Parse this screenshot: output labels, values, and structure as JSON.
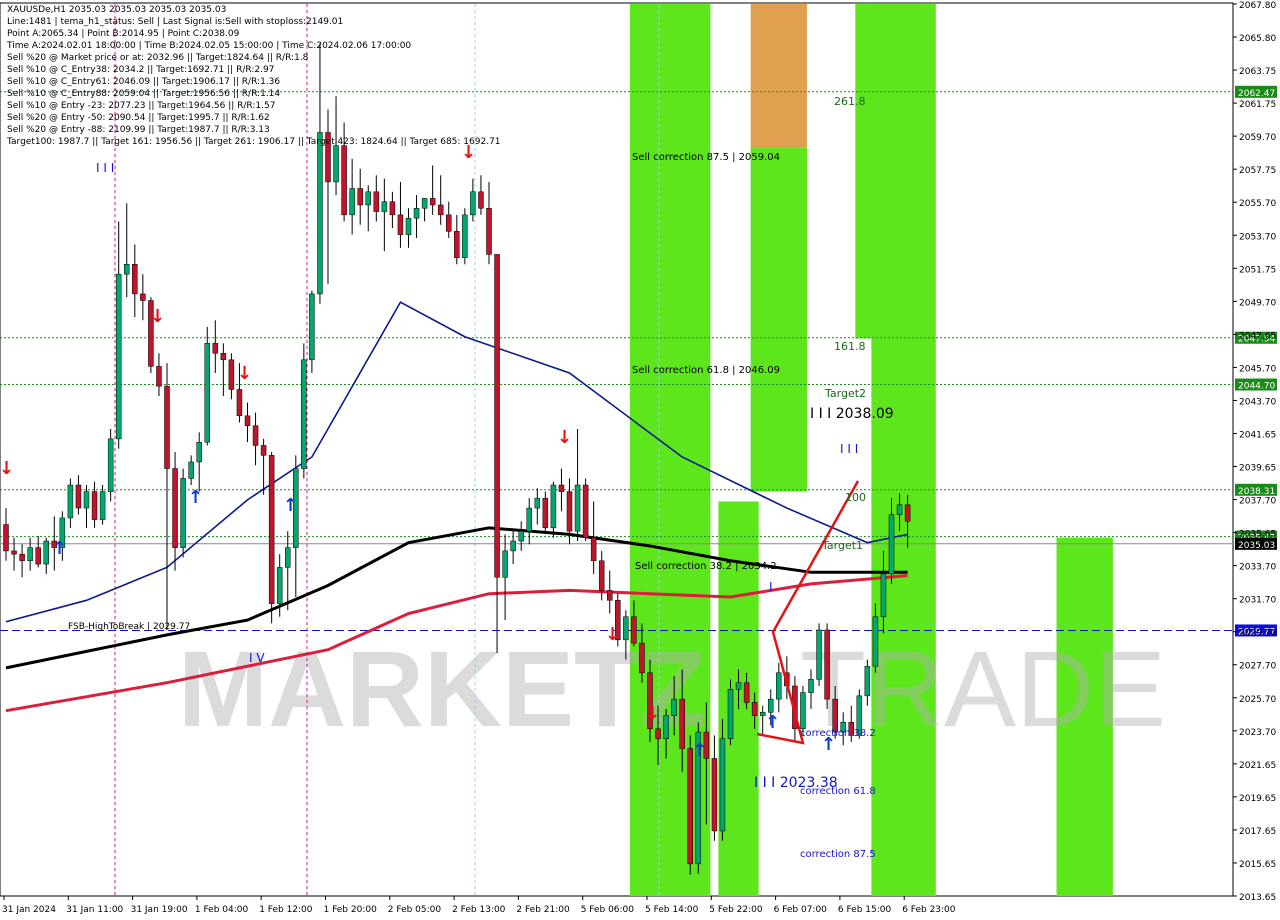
{
  "header": {
    "symbol_line": "XAUUSDe,H1  2035.03 2035.03 2035.03 2035.03",
    "lines": [
      "Line:1481 | tema_h1_status: Sell | Last Signal is:Sell with stoploss:2149.01",
      "Point A:2065.34 | Point B:2014.95 | Point C:2038.09",
      "Time A:2024.02.01 18:00:00 | Time B:2024.02.05 15:00:00 | Time C:2024.02.06 17:00:00",
      "Sell %20 @ Market price or at: 2032.96 || Target:1824.64 || R/R:1.8",
      "Sell %10 @ C_Entry38: 2034.2 || Target:1692.71 || R/R:2.97",
      "Sell %10 @ C_Entry61: 2046.09 || Target:1906.17 || R/R:1.36",
      "Sell %10 @ C_Entry88: 2059.04 || Target:1956.56 || R/R:1.14",
      "Sell %10 @ Entry -23: 2077.23 || Target:1964.56 || R/R:1.57",
      "Sell %20 @ Entry -50: 2090.54 || Target:1995.7 || R/R:1.62",
      "Sell %20 @ Entry -88: 2109.99 || Target:1987.7 || R/R:3.13",
      "Target100: 1987.7 || Target 161: 1956.56 || Target 261: 1906.17 || Target 423: 1824.64 || Target 685: 1692.71"
    ]
  },
  "watermark": {
    "left": "MARKETZ",
    "right": "TRADE"
  },
  "colors": {
    "bull": "#00a86b",
    "bear": "#c0142a",
    "green_zone": "#5ee61c",
    "orange_zone": "#e0a050",
    "gray_zone": "#7f8b99",
    "ma_blue": "#0a1a8c",
    "ma_black": "#000000",
    "ma_red": "#dc1e3c",
    "hline_green": "#1a8a1a",
    "hline_blue": "#0d0ddc",
    "price_box": "#1a8a1a"
  },
  "chart_data": {
    "type": "candlestick",
    "symbol": "XAUUSDe",
    "timeframe": "H1",
    "ylim": [
      2013.65,
      2067.8
    ],
    "y_ticks": [
      "2067.80",
      "2065.80",
      "2063.75",
      "2061.75",
      "2059.70",
      "2057.75",
      "2055.70",
      "2053.70",
      "2051.75",
      "2049.70",
      "2047.65",
      "2045.70",
      "2043.70",
      "2041.65",
      "2039.65",
      "2037.70",
      "2035.65",
      "2033.70",
      "2031.70",
      "2029.70",
      "2027.70",
      "2025.70",
      "2023.70",
      "2021.65",
      "2019.65",
      "2017.65",
      "2015.65",
      "2013.65"
    ],
    "x_ticks": [
      "31 Jan 2024",
      "31 Jan 11:00",
      "31 Jan 19:00",
      "1 Feb 04:00",
      "1 Feb 12:00",
      "1 Feb 20:00",
      "2 Feb 05:00",
      "2 Feb 13:00",
      "2 Feb 21:00",
      "5 Feb 06:00",
      "5 Feb 14:00",
      "5 Feb 22:00",
      "6 Feb 07:00",
      "6 Feb 15:00",
      "6 Feb 23:00"
    ],
    "candle_count": 113,
    "candles": [
      [
        2036.2,
        2037.2,
        2034.0,
        2034.6
      ],
      [
        2034.6,
        2035.4,
        2033.4,
        2034.4
      ],
      [
        2034.4,
        2035.0,
        2033.0,
        2034.0
      ],
      [
        2034.0,
        2035.4,
        2033.4,
        2034.8
      ],
      [
        2034.8,
        2035.5,
        2033.6,
        2033.8
      ],
      [
        2033.8,
        2035.4,
        2033.2,
        2035.2
      ],
      [
        2035.2,
        2036.7,
        2033.4,
        2034.8
      ],
      [
        2034.8,
        2037.0,
        2034.0,
        2036.6
      ],
      [
        2036.6,
        2039.0,
        2036.0,
        2038.6
      ],
      [
        2038.6,
        2039.2,
        2036.8,
        2037.2
      ],
      [
        2037.2,
        2038.6,
        2036.0,
        2038.2
      ],
      [
        2038.2,
        2038.8,
        2036.0,
        2036.5
      ],
      [
        2036.5,
        2038.6,
        2036.2,
        2038.2
      ],
      [
        2038.2,
        2042.0,
        2037.6,
        2041.4
      ],
      [
        2041.4,
        2054.6,
        2040.8,
        2051.4
      ],
      [
        2051.4,
        2055.7,
        2050.0,
        2052.0
      ],
      [
        2052.0,
        2053.2,
        2048.8,
        2050.2
      ],
      [
        2050.2,
        2051.4,
        2048.6,
        2049.8
      ],
      [
        2049.8,
        2050.0,
        2045.4,
        2045.8
      ],
      [
        2045.8,
        2046.6,
        2044.0,
        2044.6
      ],
      [
        2044.6,
        2046.0,
        2029.8,
        2039.6
      ],
      [
        2039.6,
        2040.6,
        2033.4,
        2034.8
      ],
      [
        2034.8,
        2039.6,
        2034.2,
        2039.0
      ],
      [
        2039.0,
        2040.4,
        2038.6,
        2040.0
      ],
      [
        2040.0,
        2041.8,
        2038.2,
        2041.2
      ],
      [
        2041.2,
        2048.2,
        2041.0,
        2047.2
      ],
      [
        2047.2,
        2048.6,
        2045.4,
        2046.6
      ],
      [
        2046.6,
        2047.2,
        2044.0,
        2046.2
      ],
      [
        2046.2,
        2046.6,
        2043.8,
        2044.4
      ],
      [
        2044.4,
        2046.0,
        2042.4,
        2042.8
      ],
      [
        2042.8,
        2043.6,
        2041.2,
        2042.2
      ],
      [
        2042.2,
        2043.0,
        2039.8,
        2041.0
      ],
      [
        2041.0,
        2041.4,
        2038.0,
        2040.4
      ],
      [
        2040.4,
        2040.6,
        2030.2,
        2031.4
      ],
      [
        2031.4,
        2034.4,
        2030.6,
        2033.6
      ],
      [
        2033.6,
        2035.8,
        2031.0,
        2034.8
      ],
      [
        2034.8,
        2040.4,
        2031.8,
        2039.6
      ],
      [
        2039.6,
        2047.2,
        2039.0,
        2046.2
      ],
      [
        2046.2,
        2050.4,
        2045.4,
        2050.2
      ],
      [
        2050.2,
        2065.4,
        2049.6,
        2060.0
      ],
      [
        2060.0,
        2061.4,
        2050.8,
        2057.0
      ],
      [
        2057.0,
        2062.2,
        2056.2,
        2059.2
      ],
      [
        2059.2,
        2060.6,
        2054.6,
        2055.0
      ],
      [
        2055.0,
        2058.4,
        2053.8,
        2056.6
      ],
      [
        2056.6,
        2057.8,
        2054.4,
        2055.6
      ],
      [
        2055.6,
        2056.8,
        2054.0,
        2056.4
      ],
      [
        2056.4,
        2057.4,
        2054.6,
        2055.2
      ],
      [
        2055.2,
        2057.2,
        2052.8,
        2055.8
      ],
      [
        2055.8,
        2056.4,
        2054.2,
        2055.0
      ],
      [
        2055.0,
        2057.0,
        2053.0,
        2053.8
      ],
      [
        2053.8,
        2055.4,
        2053.0,
        2054.8
      ],
      [
        2054.8,
        2056.2,
        2053.6,
        2055.4
      ],
      [
        2055.4,
        2056.0,
        2054.6,
        2056.0
      ],
      [
        2056.0,
        2058.0,
        2055.0,
        2055.6
      ],
      [
        2055.6,
        2057.4,
        2054.4,
        2055.0
      ],
      [
        2055.0,
        2055.8,
        2053.6,
        2054.0
      ],
      [
        2054.0,
        2055.0,
        2052.0,
        2052.4
      ],
      [
        2052.4,
        2055.4,
        2052.0,
        2055.0
      ],
      [
        2055.0,
        2057.2,
        2054.6,
        2056.4
      ],
      [
        2056.4,
        2057.4,
        2055.0,
        2055.4
      ],
      [
        2055.4,
        2057.0,
        2052.0,
        2052.6
      ],
      [
        2052.6,
        2034.0,
        2028.4,
        2033.0
      ],
      [
        2033.0,
        2035.6,
        2030.4,
        2034.6
      ],
      [
        2034.6,
        2035.8,
        2033.8,
        2035.2
      ],
      [
        2035.2,
        2036.4,
        2034.6,
        2035.8
      ],
      [
        2035.8,
        2037.8,
        2035.0,
        2037.2
      ],
      [
        2037.2,
        2038.4,
        2036.2,
        2037.8
      ],
      [
        2037.8,
        2038.2,
        2035.8,
        2036.0
      ],
      [
        2036.0,
        2038.8,
        2035.4,
        2038.6
      ],
      [
        2038.6,
        2039.6,
        2037.0,
        2038.2
      ],
      [
        2038.2,
        2039.0,
        2035.0,
        2035.8
      ],
      [
        2035.8,
        2042.0,
        2035.2,
        2038.6
      ],
      [
        2038.6,
        2039.0,
        2035.2,
        2035.4
      ],
      [
        2035.4,
        2037.6,
        2033.2,
        2034.0
      ],
      [
        2034.0,
        2034.6,
        2031.6,
        2032.2
      ],
      [
        2032.2,
        2033.4,
        2030.8,
        2031.6
      ],
      [
        2031.6,
        2032.0,
        2028.8,
        2029.2
      ],
      [
        2029.2,
        2031.0,
        2028.0,
        2030.6
      ],
      [
        2030.6,
        2031.6,
        2028.8,
        2029.0
      ],
      [
        2029.0,
        2030.2,
        2026.6,
        2027.2
      ],
      [
        2027.2,
        2028.0,
        2023.0,
        2023.8
      ],
      [
        2023.8,
        2025.2,
        2021.6,
        2023.2
      ],
      [
        2023.2,
        2025.0,
        2022.0,
        2024.6
      ],
      [
        2024.6,
        2027.0,
        2023.4,
        2025.6
      ],
      [
        2025.6,
        2027.4,
        2021.2,
        2022.6
      ],
      [
        2022.6,
        2023.4,
        2014.95,
        2015.6
      ],
      [
        2015.6,
        2024.2,
        2015.0,
        2023.6
      ],
      [
        2023.6,
        2025.4,
        2018.0,
        2022.0
      ],
      [
        2022.0,
        2023.4,
        2017.0,
        2017.6
      ],
      [
        2017.6,
        2024.4,
        2017.0,
        2023.2
      ],
      [
        2023.2,
        2026.8,
        2022.8,
        2026.2
      ],
      [
        2026.2,
        2027.4,
        2025.0,
        2026.6
      ],
      [
        2026.6,
        2027.2,
        2025.0,
        2025.4
      ],
      [
        2025.4,
        2026.0,
        2023.8,
        2024.6
      ],
      [
        2024.6,
        2025.2,
        2023.4,
        2024.8
      ],
      [
        2024.8,
        2026.2,
        2024.0,
        2025.6
      ],
      [
        2025.6,
        2027.8,
        2024.8,
        2027.2
      ],
      [
        2027.2,
        2028.2,
        2025.6,
        2026.4
      ],
      [
        2026.4,
        2027.0,
        2023.0,
        2023.8
      ],
      [
        2023.8,
        2026.4,
        2023.4,
        2026.0
      ],
      [
        2026.0,
        2027.4,
        2025.0,
        2026.8
      ],
      [
        2026.8,
        2030.2,
        2026.4,
        2029.8
      ],
      [
        2029.8,
        2030.2,
        2025.0,
        2025.6
      ],
      [
        2025.6,
        2026.4,
        2023.2,
        2023.6
      ],
      [
        2023.6,
        2024.8,
        2022.8,
        2024.2
      ],
      [
        2024.2,
        2025.2,
        2023.0,
        2023.4
      ],
      [
        2023.4,
        2026.2,
        2023.2,
        2025.8
      ],
      [
        2025.8,
        2028.0,
        2025.2,
        2027.6
      ],
      [
        2027.6,
        2031.4,
        2027.2,
        2030.6
      ],
      [
        2030.6,
        2034.6,
        2029.6,
        2033.2
      ],
      [
        2033.2,
        2037.8,
        2032.6,
        2036.8
      ],
      [
        2036.8,
        2038.09,
        2035.8,
        2037.4
      ],
      [
        2037.4,
        2038.0,
        2034.8,
        2036.4
      ]
    ],
    "moving_averages": [
      {
        "name": "blue",
        "points": [
          [
            0,
            2030.3
          ],
          [
            10,
            2031.6
          ],
          [
            20,
            2033.6
          ],
          [
            30,
            2037.7
          ],
          [
            38,
            2040.3
          ],
          [
            49,
            2049.7
          ],
          [
            57,
            2047.6
          ],
          [
            70,
            2045.4
          ],
          [
            84,
            2040.3
          ],
          [
            97,
            2037.2
          ],
          [
            107,
            2035.1
          ],
          [
            112,
            2035.6
          ]
        ]
      },
      {
        "name": "black",
        "points": [
          [
            0,
            2027.5
          ],
          [
            10,
            2028.5
          ],
          [
            20,
            2029.5
          ],
          [
            30,
            2030.4
          ],
          [
            40,
            2032.5
          ],
          [
            50,
            2035.1
          ],
          [
            60,
            2036.0
          ],
          [
            70,
            2035.6
          ],
          [
            80,
            2034.9
          ],
          [
            90,
            2034.0
          ],
          [
            100,
            2033.3
          ],
          [
            112,
            2033.3
          ]
        ]
      },
      {
        "name": "red",
        "points": [
          [
            0,
            2024.9
          ],
          [
            20,
            2026.6
          ],
          [
            40,
            2028.6
          ],
          [
            50,
            2030.8
          ],
          [
            60,
            2032.0
          ],
          [
            70,
            2032.2
          ],
          [
            80,
            2032.0
          ],
          [
            90,
            2031.8
          ],
          [
            100,
            2032.6
          ],
          [
            112,
            2033.1
          ]
        ]
      }
    ],
    "zones": [
      {
        "color": "green",
        "x_from": 78,
        "x_to": 87,
        "y_top": 2067.8,
        "y_bottom": 2013.65
      },
      {
        "color": "green",
        "x_from": 89,
        "x_to": 93,
        "y_top": 2037.6,
        "y_bottom": 2013.65
      },
      {
        "color": "orange",
        "x_from": 93,
        "x_to": 99,
        "y_top": 2067.8,
        "y_bottom": 2059.1
      },
      {
        "color": "green",
        "x_from": 93,
        "x_to": 99,
        "y_top": 2059.1,
        "y_bottom": 2038.2
      },
      {
        "color": "green",
        "x_from": 106,
        "x_to": 112,
        "y_top": 2067.8,
        "y_bottom": 2047.5
      },
      {
        "color": "green",
        "x_from": 108,
        "x_to": 112,
        "y_top": 2047.5,
        "y_bottom": 2013.65
      },
      {
        "color": "green",
        "x_from": 112,
        "x_to": 115,
        "y_top": 2067.8,
        "y_bottom": 2013.65
      },
      {
        "color": "green",
        "x_from": 131,
        "x_to": 137,
        "y_top": 2035.4,
        "y_bottom": 2013.65
      }
    ],
    "hlines": [
      {
        "value": 2062.47,
        "label": "2062.47",
        "color": "green"
      },
      {
        "value": 2047.54,
        "label": "2047.54",
        "color": "green"
      },
      {
        "value": 2044.7,
        "label": "2044.70",
        "color": "green"
      },
      {
        "value": 2038.31,
        "label": "2038.31",
        "color": "green"
      },
      {
        "value": 2035.47,
        "label": "2035.47",
        "color": "green"
      },
      {
        "value": 2029.77,
        "label": "2029.77",
        "color": "blue"
      }
    ],
    "current_price": "2035.03",
    "annotations": [
      {
        "text": "Sell correction 87.5 | 2059.04",
        "value": 2059.04
      },
      {
        "text": "Sell correction 61.8 | 2046.09",
        "value": 2046.09
      },
      {
        "text": "Sell correction 38.2 | 2034.2",
        "value": 2034.2
      },
      {
        "text": "261.8"
      },
      {
        "text": "161.8"
      },
      {
        "text": "100"
      },
      {
        "text": "Target2"
      },
      {
        "text": "Target1"
      },
      {
        "text": "I I I 2038.09"
      },
      {
        "text": "I I I 2023.38"
      },
      {
        "text": "I I I"
      },
      {
        "text": "I V"
      },
      {
        "text": "I"
      },
      {
        "text": "correction 38.2"
      },
      {
        "text": "correction 61.8"
      },
      {
        "text": "correction 87.5"
      },
      {
        "text": "FSB-HighToBreak | 2029.77"
      }
    ]
  }
}
